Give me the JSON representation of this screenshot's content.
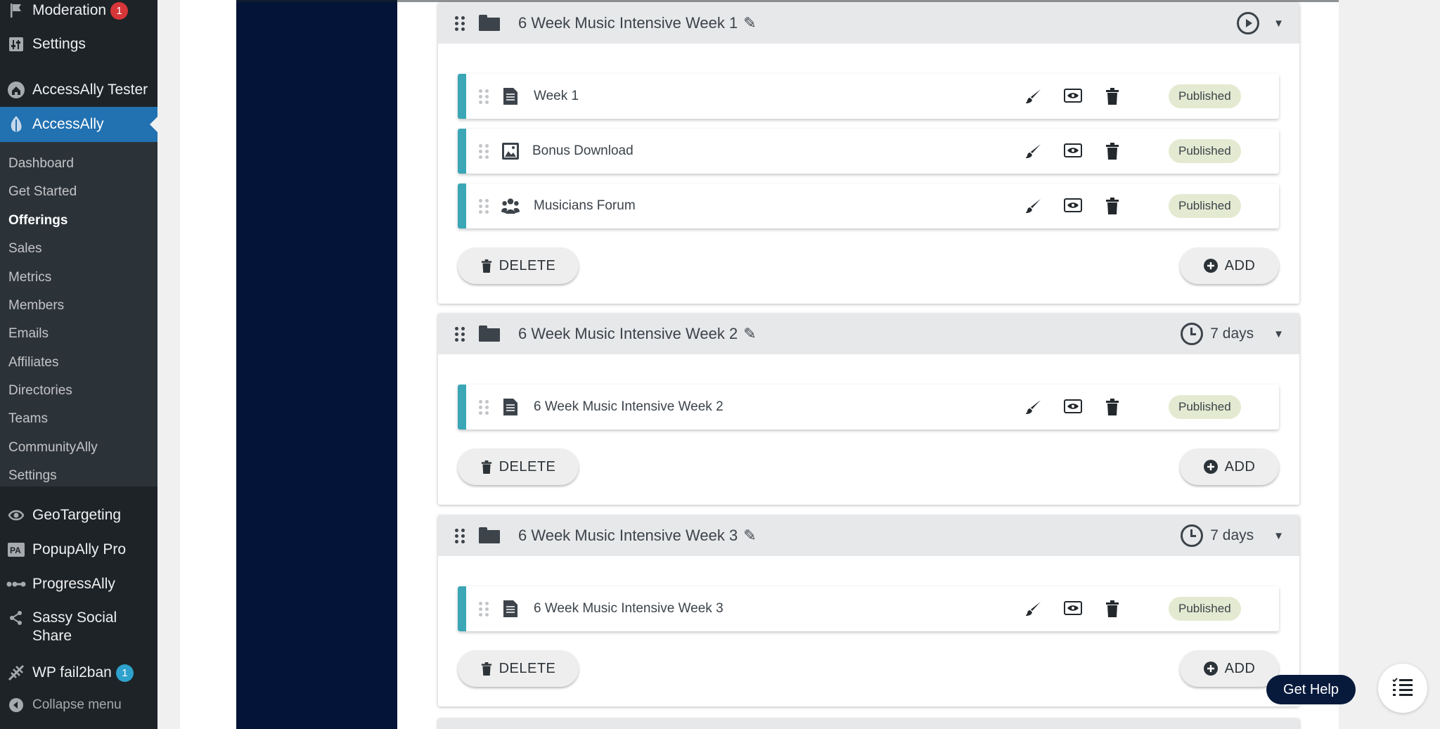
{
  "sidebar": {
    "moderation": {
      "label": "Moderation",
      "badge": "1",
      "icon": "flag-icon"
    },
    "settings_top": {
      "label": "Settings",
      "icon": "settings-sliders-icon"
    },
    "accessally_tester": {
      "label": "AccessAlly Tester",
      "icon": "home-icon"
    },
    "accessally": {
      "label": "AccessAlly",
      "icon": "accessally-leaf-icon"
    },
    "submenu": [
      {
        "label": "Dashboard"
      },
      {
        "label": "Get Started"
      },
      {
        "label": "Offerings",
        "active": true
      },
      {
        "label": "Sales"
      },
      {
        "label": "Metrics"
      },
      {
        "label": "Members"
      },
      {
        "label": "Emails"
      },
      {
        "label": "Affiliates"
      },
      {
        "label": "Directories"
      },
      {
        "label": "Teams"
      },
      {
        "label": "CommunityAlly"
      },
      {
        "label": "Settings"
      }
    ],
    "geotargeting": {
      "label": "GeoTargeting",
      "icon": "geotargeting-icon"
    },
    "popupally": {
      "label": "PopupAlly Pro",
      "icon": "pa-icon"
    },
    "progressally": {
      "label": "ProgressAlly",
      "icon": "progress-icon"
    },
    "sassy": {
      "label": "Sassy Social Share",
      "icon": "share-icon"
    },
    "fail2ban": {
      "label": "WP fail2ban",
      "badge": "1",
      "icon": "fail2ban-icon"
    },
    "collapse": {
      "label": "Collapse menu",
      "icon": "collapse-icon"
    }
  },
  "modules": [
    {
      "title": "6 Week Music Intensive Week 1",
      "schedule_icon": "play-circle-icon",
      "days": "",
      "items": [
        {
          "title": "Week 1",
          "icon": "page-icon",
          "status": "Published"
        },
        {
          "title": "Bonus Download",
          "icon": "image-icon",
          "status": "Published"
        },
        {
          "title": "Musicians Forum",
          "icon": "group-icon",
          "status": "Published"
        }
      ]
    },
    {
      "title": "6 Week Music Intensive Week 2",
      "schedule_icon": "clock-icon",
      "days": "7 days",
      "items": [
        {
          "title": "6 Week Music Intensive Week 2",
          "icon": "page-icon",
          "status": "Published"
        }
      ]
    },
    {
      "title": "6 Week Music Intensive Week 3",
      "schedule_icon": "clock-icon",
      "days": "7 days",
      "items": [
        {
          "title": "6 Week Music Intensive Week 3",
          "icon": "page-icon",
          "status": "Published"
        }
      ]
    }
  ],
  "buttons": {
    "delete": "DELETE",
    "add": "ADD"
  },
  "help": {
    "label": "Get Help"
  },
  "colors": {
    "sidebar": "#1d2327",
    "active_menu": "#2271b1",
    "navy_panel": "#031438",
    "item_accent": "#3ba7b6",
    "status_bg": "#e4ead1"
  }
}
